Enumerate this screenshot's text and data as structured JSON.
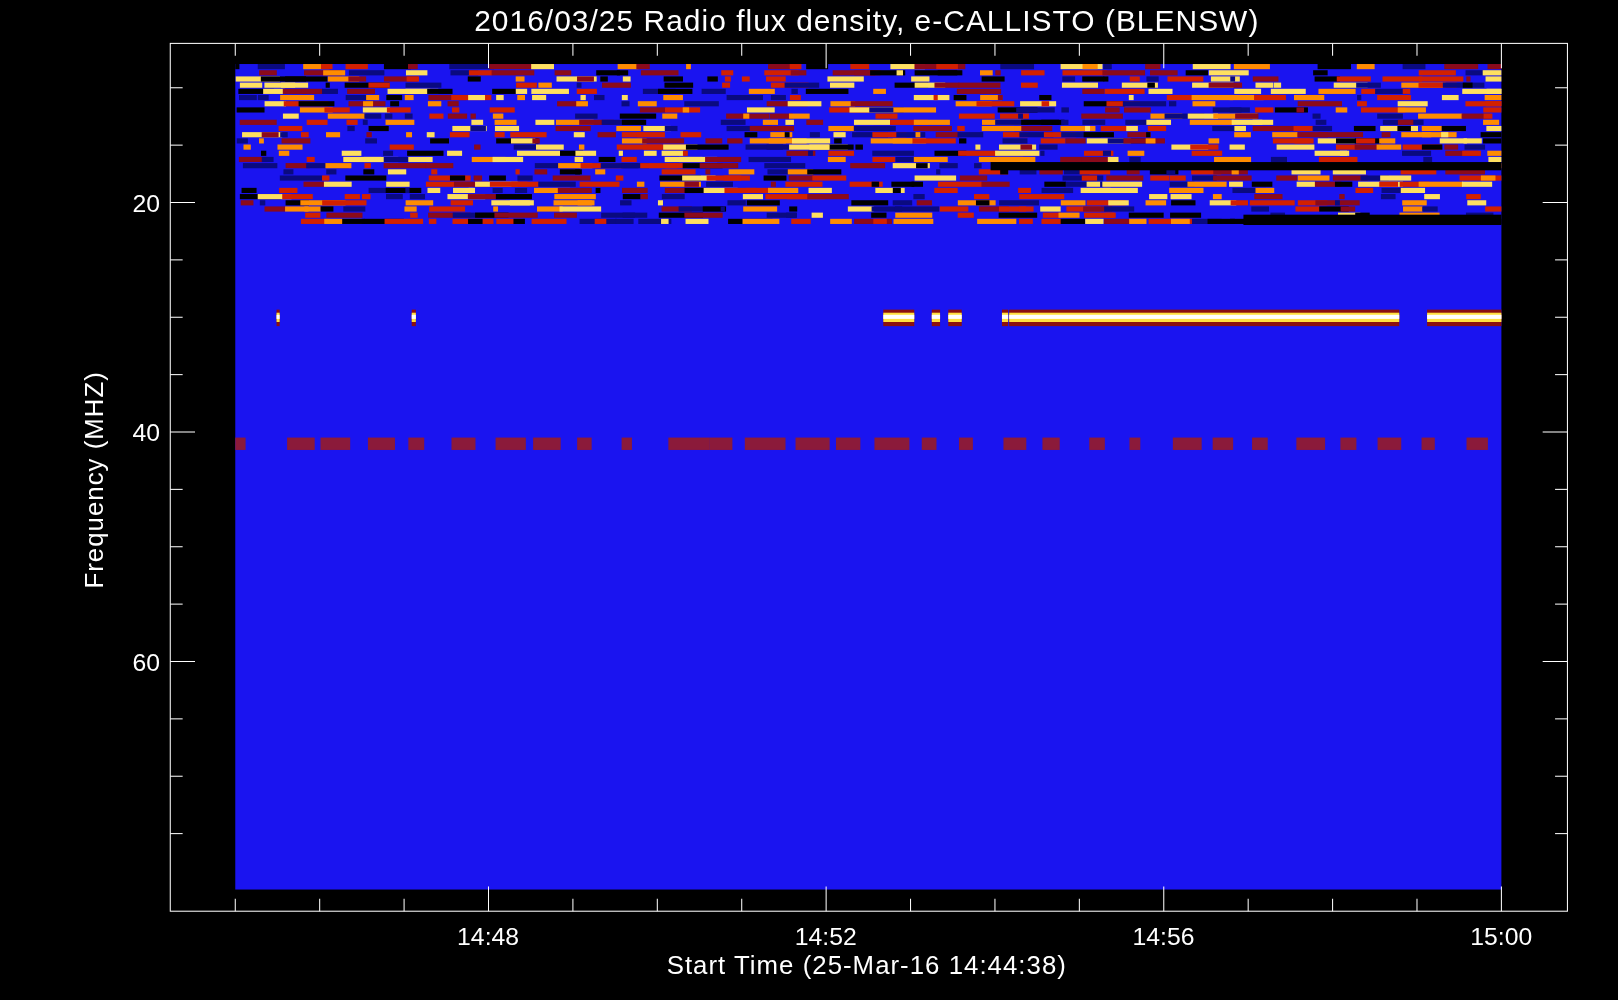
{
  "plot": {
    "title": "2016/03/25  Radio flux density, e-CALLISTO (BLENSW)",
    "ylabel": "Frequency (MHZ)",
    "xlabel": "Start Time (25-Mar-16 14:44:38)",
    "yticks": [
      "20",
      "40",
      "60"
    ],
    "xticks": [
      "14:48",
      "14:52",
      "14:56",
      "15:00"
    ]
  }
}
